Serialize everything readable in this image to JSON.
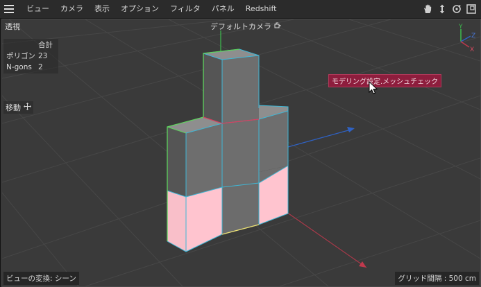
{
  "menubar": {
    "menu_icon": "hamburger-menu-icon",
    "items": [
      "ビュー",
      "カメラ",
      "表示",
      "オプション",
      "フィルタ",
      "パネル",
      "Redshift"
    ],
    "right_icons": [
      "hand-pan-icon",
      "move-arrows-icon",
      "rotate-icon",
      "maximize-view-icon"
    ]
  },
  "viewport": {
    "view_name": "透視",
    "camera_name": "デフォルトカメラ",
    "camera_icon": "camera-link-icon",
    "stats": {
      "header": "合計",
      "rows": [
        {
          "label": "ポリゴン",
          "value": "23"
        },
        {
          "label": "N-gons",
          "value": "2"
        }
      ]
    },
    "tool_label": "移動",
    "tool_icon": "move-crosshair-icon",
    "tooltip": "モデリング設定.メッシュチェック",
    "status_left": "ビューの変換: シーン",
    "status_right": "グリッド間隔 : 500 cm",
    "axis_labels": {
      "y": "Y",
      "z": "Z",
      "x": "X"
    }
  },
  "colors": {
    "background": "#3a3a3a",
    "cube_face": "#6b6b6b",
    "highlight_face": "#ffc0cb",
    "edge": "#3fb7d6",
    "x_axis": "#c0394d",
    "y_axis": "#3cbd4d",
    "z_axis": "#2f62c4",
    "tooltip_bg": "#8e1d3d"
  }
}
